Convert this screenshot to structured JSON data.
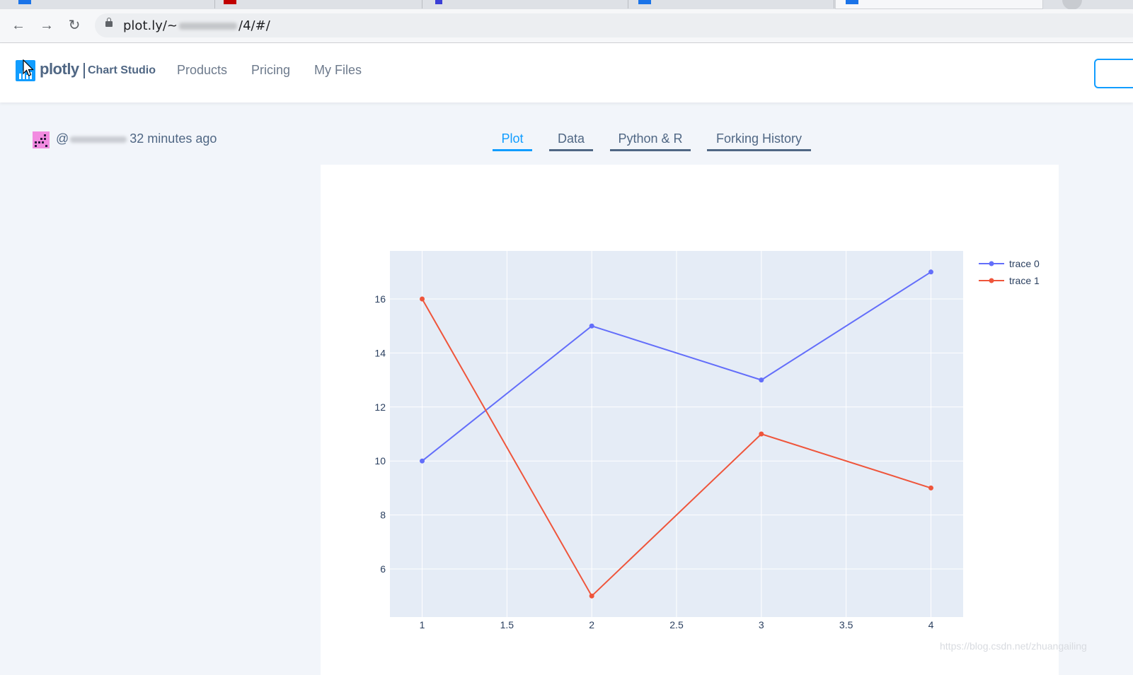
{
  "browser": {
    "url_prefix": "plot.ly/~",
    "url_suffix": "/4/#/"
  },
  "header": {
    "logo_text": "plotly",
    "logo_sub": "Chart Studio",
    "nav": [
      {
        "label": "Products"
      },
      {
        "label": "Pricing"
      },
      {
        "label": "My Files"
      }
    ]
  },
  "meta": {
    "author_prefix": "@",
    "time_ago": "32 minutes ago"
  },
  "tabs": [
    {
      "label": "Plot",
      "active": true
    },
    {
      "label": "Data",
      "active": false
    },
    {
      "label": "Python & R",
      "active": false
    },
    {
      "label": "Forking History",
      "active": false
    }
  ],
  "colors": {
    "accent": "#119dff",
    "trace0": "#636efa",
    "trace1": "#ef553b",
    "plot_bg": "#e5ecf6"
  },
  "chart_data": {
    "type": "line",
    "x_ticks": [
      1,
      1.5,
      2,
      2.5,
      3,
      3.5,
      4
    ],
    "y_ticks": [
      6,
      8,
      10,
      12,
      14,
      16
    ],
    "xlim": [
      0.81,
      4.19
    ],
    "ylim": [
      4.22,
      17.78
    ],
    "grid": true,
    "legend": "top-right",
    "series": [
      {
        "name": "trace 0",
        "x": [
          1,
          2,
          3,
          4
        ],
        "y": [
          10,
          15,
          13,
          17
        ],
        "color": "#636efa"
      },
      {
        "name": "trace 1",
        "x": [
          1,
          2,
          3,
          4
        ],
        "y": [
          16,
          5,
          11,
          9
        ],
        "color": "#ef553b"
      }
    ]
  },
  "watermark": "https://blog.csdn.net/zhuangailing"
}
